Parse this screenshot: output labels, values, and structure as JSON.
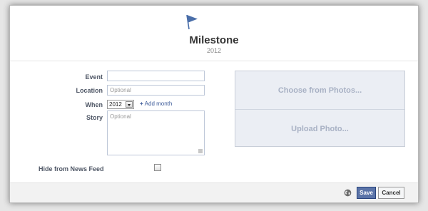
{
  "header": {
    "icon": "flag-icon",
    "title": "Milestone",
    "year": "2012"
  },
  "form": {
    "event_label": "Event",
    "event_value": "",
    "location_label": "Location",
    "location_placeholder": "Optional",
    "when_label": "When",
    "when_selected": "2012",
    "add_month": "Add month",
    "story_label": "Story",
    "story_placeholder": "Optional",
    "hide_label": "Hide from News Feed",
    "hide_checked": false
  },
  "photos": {
    "choose": "Choose from Photos...",
    "upload": "Upload Photo..."
  },
  "footer": {
    "privacy_icon": "globe-icon",
    "save": "Save",
    "cancel": "Cancel"
  },
  "colors": {
    "accent": "#3b5998",
    "save_button": "#5b74a8",
    "photo_panel": "#ebeef4"
  }
}
